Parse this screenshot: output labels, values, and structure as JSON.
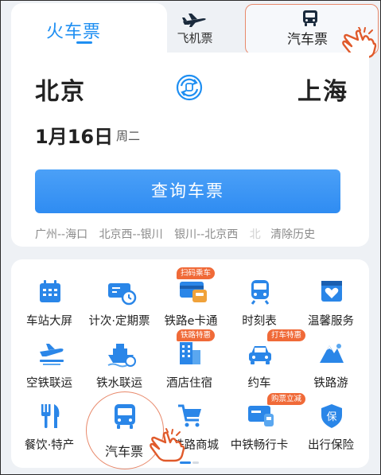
{
  "tabs": {
    "train": "火车票",
    "flight": "飞机票",
    "bus": "汽车票"
  },
  "trip": {
    "from": "北京",
    "to": "上海",
    "date": "1月16日",
    "weekday": "周二"
  },
  "search_button": "查询车票",
  "history": {
    "items": [
      "广州--海口",
      "北京西--银川",
      "银川--北京西"
    ],
    "overflow_text": "北",
    "clear_label": "清除历史"
  },
  "services": [
    {
      "label": "车站大屏",
      "icon": "calendar-screen-icon",
      "badge": ""
    },
    {
      "label": "计次·定期票",
      "icon": "ticket-clock-icon",
      "badge": ""
    },
    {
      "label": "铁路e卡通",
      "icon": "e-card-icon",
      "badge": "扫码乘车"
    },
    {
      "label": "时刻表",
      "icon": "train-front-icon",
      "badge": ""
    },
    {
      "label": "温馨服务",
      "icon": "heart-service-icon",
      "badge": ""
    },
    {
      "label": "空铁联运",
      "icon": "plane-rail-icon",
      "badge": ""
    },
    {
      "label": "铁水联运",
      "icon": "ship-icon",
      "badge": ""
    },
    {
      "label": "酒店住宿",
      "icon": "hotel-icon",
      "badge": "铁路特惠"
    },
    {
      "label": "约车",
      "icon": "car-icon",
      "badge": "打车特惠"
    },
    {
      "label": "铁路游",
      "icon": "mountain-icon",
      "badge": ""
    },
    {
      "label": "餐饮·特产",
      "icon": "fork-knife-icon",
      "badge": ""
    },
    {
      "label": "汽车票",
      "icon": "bus-icon",
      "badge": ""
    },
    {
      "label": "铁路商城",
      "icon": "cart-icon",
      "badge": ""
    },
    {
      "label": "中铁畅行卡",
      "icon": "rail-card-icon",
      "badge": "购票立减"
    },
    {
      "label": "出行保险",
      "icon": "insurance-shield-icon",
      "badge": ""
    }
  ],
  "insurance_glyph": "保",
  "colors": {
    "accent": "#1f8ff2",
    "badge": "#f06a38",
    "highlight": "#e8896b"
  }
}
